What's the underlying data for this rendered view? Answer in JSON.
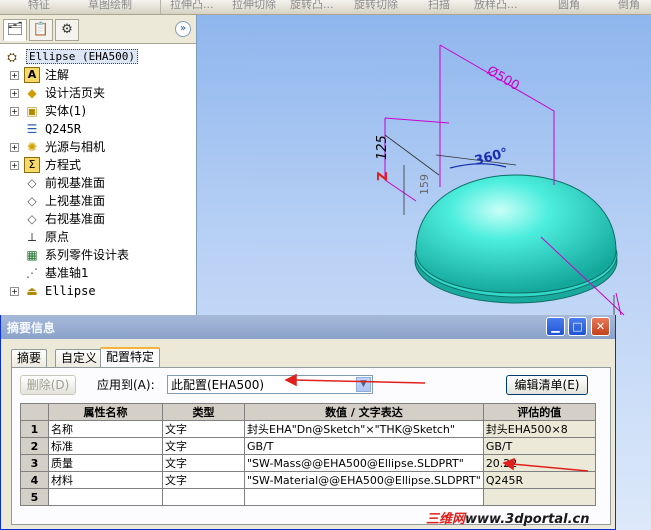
{
  "toolbar": {
    "items": [
      "特征",
      "草图绘制",
      "拉伸凸...",
      "拉伸切除",
      "旋转凸...",
      "旋转切除",
      "扫描",
      "放样凸...",
      "圆角",
      "倒角"
    ]
  },
  "feature_manager": {
    "expand_glyph": "»",
    "root": {
      "name": "Ellipse  (EHA500)",
      "icon": "part-icon"
    },
    "items": [
      {
        "label": "注解",
        "icon": "annotation-icon",
        "expandable": true
      },
      {
        "label": "设计活页夹",
        "icon": "design-binder-icon",
        "expandable": true
      },
      {
        "label": "实体(1)",
        "icon": "solid-body-icon",
        "expandable": true
      },
      {
        "label": "Q245R",
        "icon": "material-icon",
        "expandable": false
      },
      {
        "label": "光源与相机",
        "icon": "lights-icon",
        "expandable": true
      },
      {
        "label": "方程式",
        "icon": "equation-icon",
        "expandable": true
      },
      {
        "label": "前视基准面",
        "icon": "plane-icon",
        "expandable": false
      },
      {
        "label": "上视基准面",
        "icon": "plane-icon",
        "expandable": false
      },
      {
        "label": "右视基准面",
        "icon": "plane-icon",
        "expandable": false
      },
      {
        "label": "原点",
        "icon": "origin-icon",
        "expandable": false
      },
      {
        "label": "系列零件设计表",
        "icon": "design-table-icon",
        "expandable": false
      },
      {
        "label": "基准轴1",
        "icon": "axis-icon",
        "expandable": false
      },
      {
        "label": "Ellipse",
        "icon": "revolve-icon",
        "expandable": true
      }
    ]
  },
  "model_view": {
    "dim_diameter": "Ø500",
    "dim_height": "125",
    "dim_small": "159",
    "dim_angle": "360°",
    "dim_z": "Z",
    "colors": {
      "body": "#2fd8c8",
      "dimension": "#cc00cc",
      "blue_dim": "#1a2fb0"
    }
  },
  "dialog": {
    "title": "摘要信息",
    "tabs": [
      "摘要",
      "自定义",
      "配置特定"
    ],
    "active_tab": "配置特定",
    "delete_button": "删除(D)",
    "apply_label": "应用到(A):",
    "apply_value": "此配置(EHA500)",
    "edit_list_button": "编辑清单(E)",
    "table": {
      "headers": [
        "",
        "属性名称",
        "类型",
        "数值 / 文字表达",
        "评估的值"
      ],
      "rows": [
        {
          "n": "1",
          "name": "名称",
          "type": "文字",
          "value": "封头EHA\"Dn@Sketch\"×\"THK@Sketch\"",
          "eval": "封头EHA500×8"
        },
        {
          "n": "2",
          "name": "标准",
          "type": "文字",
          "value": "GB/T",
          "eval": "GB/T"
        },
        {
          "n": "3",
          "name": "质量",
          "type": "文字",
          "value": "\"SW-Mass@@EHA500@Ellipse.SLDPRT\"",
          "eval": "20.22"
        },
        {
          "n": "4",
          "name": "材料",
          "type": "文字",
          "value": "\"SW-Material@@EHA500@Ellipse.SLDPRT\"",
          "eval": "Q245R"
        },
        {
          "n": "5",
          "name": "",
          "type": "",
          "value": "",
          "eval": ""
        }
      ]
    }
  },
  "watermark": {
    "red": "三维网",
    "url": "www.3dportal.cn"
  },
  "annotation_color": "#e0201c"
}
